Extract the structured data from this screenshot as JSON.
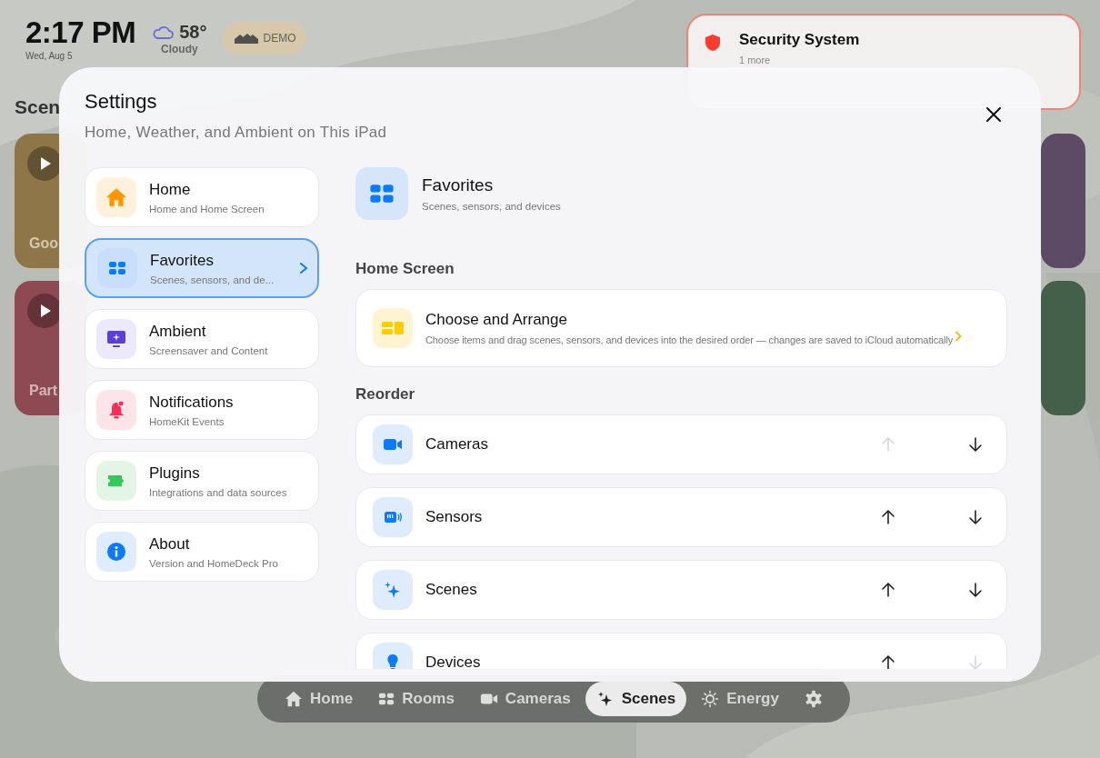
{
  "status": {
    "time": "2:17 PM",
    "date": "Wed, Aug 5",
    "temperature": "58°",
    "condition": "Cloudy",
    "badge": "DEMO"
  },
  "notification": {
    "title": "Security System",
    "subtitle": "1 more"
  },
  "background": {
    "section_title": "Scen",
    "tiles": [
      {
        "label": "Goo",
        "kind": "gold"
      },
      {
        "label": "Part",
        "kind": "red"
      }
    ]
  },
  "modal": {
    "title": "Settings",
    "subtitle": "Home, Weather, and Ambient on This iPad",
    "sidebar": {
      "items": [
        {
          "kind": "home",
          "title": "Home",
          "subtitle": "Home and Home Screen",
          "selected": false
        },
        {
          "kind": "favorites",
          "title": "Favorites",
          "subtitle": "Scenes, sensors, and de...",
          "selected": true
        },
        {
          "kind": "ambient",
          "title": "Ambient",
          "subtitle": "Screensaver and Content",
          "selected": false
        },
        {
          "kind": "notifications",
          "title": "Notifications",
          "subtitle": "HomeKit Events",
          "selected": false
        },
        {
          "kind": "plugins",
          "title": "Plugins",
          "subtitle": "Integrations and data sources",
          "selected": false
        },
        {
          "kind": "about",
          "title": "About",
          "subtitle": "Version and HomeDeck Pro",
          "selected": false
        }
      ]
    },
    "detail": {
      "title": "Favorites",
      "subtitle": "Scenes, sensors, and devices",
      "home_screen": {
        "heading": "Home Screen",
        "title": "Choose and Arrange",
        "description": "Choose items and drag scenes, sensors, and devices into the desired order — changes are saved to iCloud automatically"
      },
      "reorder": {
        "heading": "Reorder",
        "rows": [
          {
            "kind": "cameras",
            "label": "Cameras",
            "up_disabled": true,
            "down_disabled": false
          },
          {
            "kind": "sensors",
            "label": "Sensors",
            "up_disabled": false,
            "down_disabled": false
          },
          {
            "kind": "scenes",
            "label": "Scenes",
            "up_disabled": false,
            "down_disabled": false
          },
          {
            "kind": "devices",
            "label": "Devices",
            "up_disabled": false,
            "down_disabled": true
          }
        ]
      }
    }
  },
  "tab_bar": {
    "items": [
      {
        "kind": "home",
        "label": "Home",
        "selected": false
      },
      {
        "kind": "rooms",
        "label": "Rooms",
        "selected": false
      },
      {
        "kind": "cameras",
        "label": "Cameras",
        "selected": false
      },
      {
        "kind": "scenes",
        "label": "Scenes",
        "selected": true
      },
      {
        "kind": "energy",
        "label": "Energy",
        "selected": false
      },
      {
        "kind": "settings",
        "selected": false
      }
    ]
  }
}
